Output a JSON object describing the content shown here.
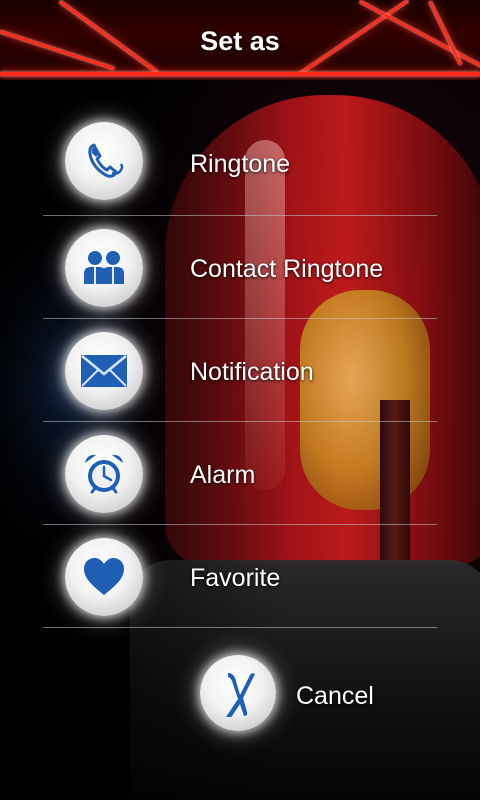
{
  "header": {
    "title": "Set as"
  },
  "menu": {
    "items": [
      {
        "label": "Ringtone",
        "icon": "phone-icon"
      },
      {
        "label": "Contact Ringtone",
        "icon": "contacts-icon"
      },
      {
        "label": "Notification",
        "icon": "envelope-icon"
      },
      {
        "label": "Alarm",
        "icon": "alarm-clock-icon"
      },
      {
        "label": "Favorite",
        "icon": "heart-icon"
      }
    ]
  },
  "cancel": {
    "label": "Cancel",
    "icon": "x-icon"
  },
  "colors": {
    "accent_red": "#ff2a1a",
    "icon_blue": "#1f5fb4",
    "text": "#ffffff"
  }
}
